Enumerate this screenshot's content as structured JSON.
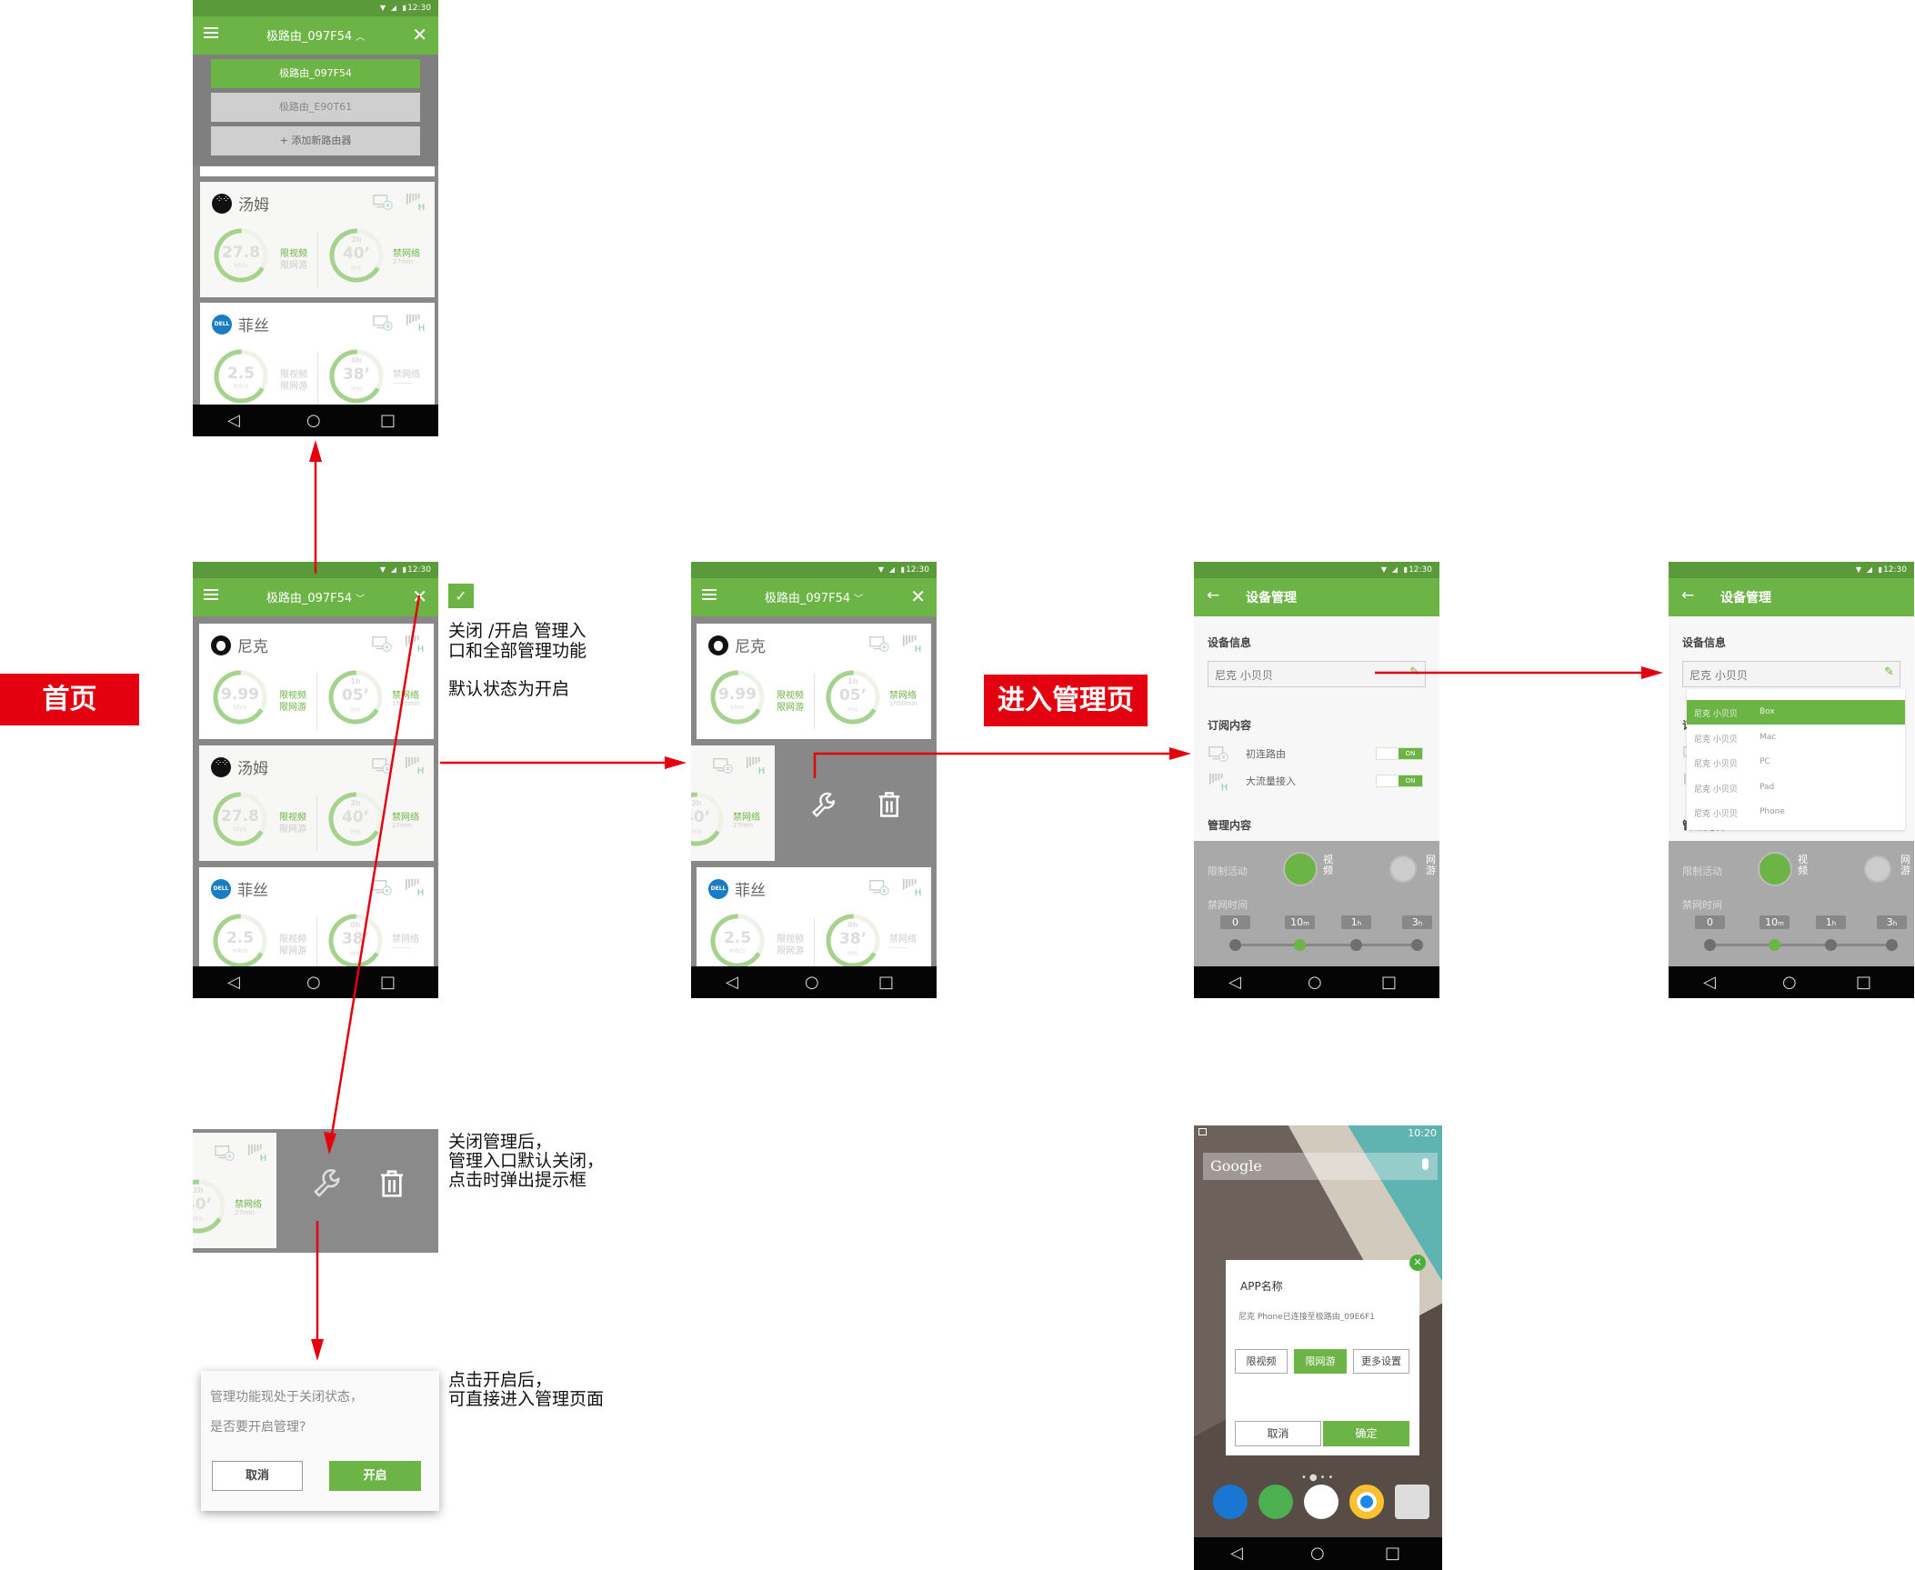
{
  "labels": {
    "home": "首页",
    "manage_page": "进入管理页"
  },
  "annotations": {
    "toggle_note": [
      "关闭 /开启 管理入",
      "口和全部管理功能"
    ],
    "default_note": "默认状态为开启",
    "closed_note": [
      "关闭管理后，",
      "管理入口默认关闭，",
      "点击时弹出提示框"
    ],
    "open_note": [
      "点击开启后，",
      "可直接进入管理页面"
    ]
  },
  "status_bar": {
    "time": "12:30"
  },
  "router": {
    "current": "极路由_097F54",
    "list": [
      "极路由_097F54",
      "极路由_E90T61"
    ],
    "add": "+ 添加新路由器"
  },
  "devices": [
    {
      "name": "尼克",
      "type": "Mac",
      "icon": "apple-logo",
      "speed": "9.99",
      "speed_unit": "kb/s",
      "limit_video": "限视频",
      "limit_game": "限网游",
      "video_on": true,
      "game_on": true,
      "time_h": "1h",
      "time_m": "05’",
      "time_label": "时长",
      "ban": "禁网络",
      "ban_on": true,
      "ban_detail": "1h50min"
    },
    {
      "name": "汤姆",
      "type": "Phone",
      "icon": "blackberry-logo",
      "speed": "27.8",
      "speed_unit": "kb/s",
      "limit_video": "限视频",
      "limit_game": "限网游",
      "video_on": true,
      "game_on": false,
      "time_h": "2h",
      "time_m": "40’",
      "time_label": "时长",
      "ban": "禁网络",
      "ban_on": true,
      "ban_detail": "27min"
    },
    {
      "name": "菲丝",
      "type": "PC",
      "icon": "dell-logo",
      "logo_text": "DELL",
      "speed": "2.5",
      "speed_unit": "mb/s",
      "limit_video": "限视频",
      "limit_game": "限网游",
      "video_on": false,
      "game_on": false,
      "time_h": "0h",
      "time_m": "38’",
      "time_label": "时长",
      "ban": "禁网络",
      "ban_on": false,
      "ban_detail": "———"
    }
  ],
  "device_manage": {
    "title": "设备管理",
    "info_heading": "设备信息",
    "name_value": "尼克 小贝贝",
    "subscribe_heading": "订阅内容",
    "subscriptions": [
      {
        "label": "初连路由",
        "state": "ON"
      },
      {
        "label": "大流量接入",
        "state": "ON"
      }
    ],
    "manage_heading": "管理内容",
    "limit_label": "限制活动",
    "limit_options": [
      {
        "label": "视频",
        "active": true
      },
      {
        "label": "网游",
        "active": false
      }
    ],
    "ban_label": "禁网时间",
    "ban_steps": [
      {
        "value": "0",
        "unit": ""
      },
      {
        "value": "10",
        "unit": "m"
      },
      {
        "value": "1",
        "unit": "h"
      },
      {
        "value": "3",
        "unit": "h"
      }
    ],
    "ban_selected": 1,
    "type_options": [
      {
        "name": "尼克 小贝贝",
        "type": "Box"
      },
      {
        "name": "尼克 小贝贝",
        "type": "Mac"
      },
      {
        "name": "尼克 小贝贝",
        "type": "PC"
      },
      {
        "name": "尼克 小贝贝",
        "type": "Pad"
      },
      {
        "name": "尼克 小贝贝",
        "type": "Phone"
      }
    ],
    "type_selected": 0
  },
  "prompt_dialog": {
    "lines": [
      "管理功能现处于关闭状态，",
      "是否要开启管理?"
    ],
    "cancel": "取消",
    "confirm": "开启"
  },
  "home_screen": {
    "time": "10:20",
    "search": "Google",
    "dialog": {
      "title": "APP名称",
      "message": "尼克 Phone已连接至极路由_09E6F1",
      "options": [
        {
          "label": "限视频",
          "active": false
        },
        {
          "label": "限网游",
          "active": true
        },
        {
          "label": "更多设置",
          "active": false
        }
      ],
      "cancel": "取消",
      "confirm": "确定"
    }
  },
  "colors": {
    "brand_green": "#6db446",
    "status_green": "#5a9a3a",
    "arrow_red": "#e3000f",
    "ring_green": "#a5d38d"
  }
}
